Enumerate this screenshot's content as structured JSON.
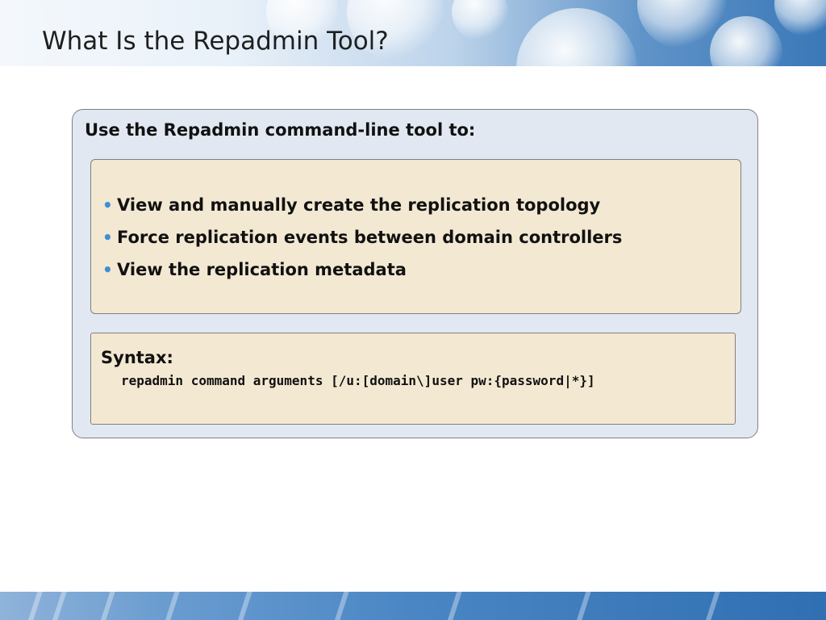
{
  "slide": {
    "title": "What Is the Repadmin Tool?",
    "lead": "Use the Repadmin command-line tool to:",
    "bullets": [
      "View and manually create the replication topology",
      "Force replication events between domain controllers",
      "View the replication metadata"
    ],
    "syntax_label": "Syntax:",
    "syntax_code": "repadmin command arguments [/u:[domain\\]user pw:{password|*}]"
  },
  "colors": {
    "bullet": "#3d8fd6",
    "panel": "#e1e8f1",
    "box": "#f3e8d2",
    "header_accent": "#3b78b8"
  }
}
